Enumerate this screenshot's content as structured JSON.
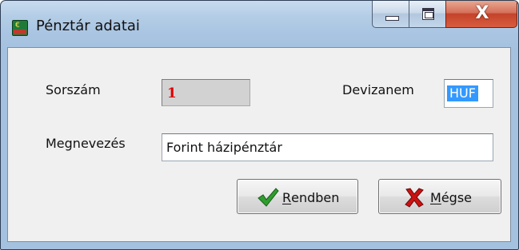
{
  "window": {
    "title": "Pénztár adatai",
    "icon": "cash-register-app-icon",
    "controls": {
      "minimize_icon": "minimize-icon",
      "maximize_icon": "maximize-icon",
      "close_glyph": "X"
    }
  },
  "form": {
    "sorszam_label": "Sorszám",
    "sorszam_value": "1",
    "devizanem_label": "Devizanem",
    "devizanem_value": "HUF",
    "megnevezes_label": "Megnevezés",
    "megnevezes_value": "Forint házipénztár"
  },
  "buttons": {
    "ok": {
      "accel": "R",
      "rest": "endben",
      "icon": "checkmark-icon",
      "icon_color": "#2e9e2e"
    },
    "cancel": {
      "accel": "M",
      "rest": "égse",
      "icon": "cross-icon",
      "icon_color": "#cc1111"
    }
  },
  "colors": {
    "sorszam_value": "#e00000",
    "selection": "#3399ff",
    "close_button": "#c4432a"
  }
}
